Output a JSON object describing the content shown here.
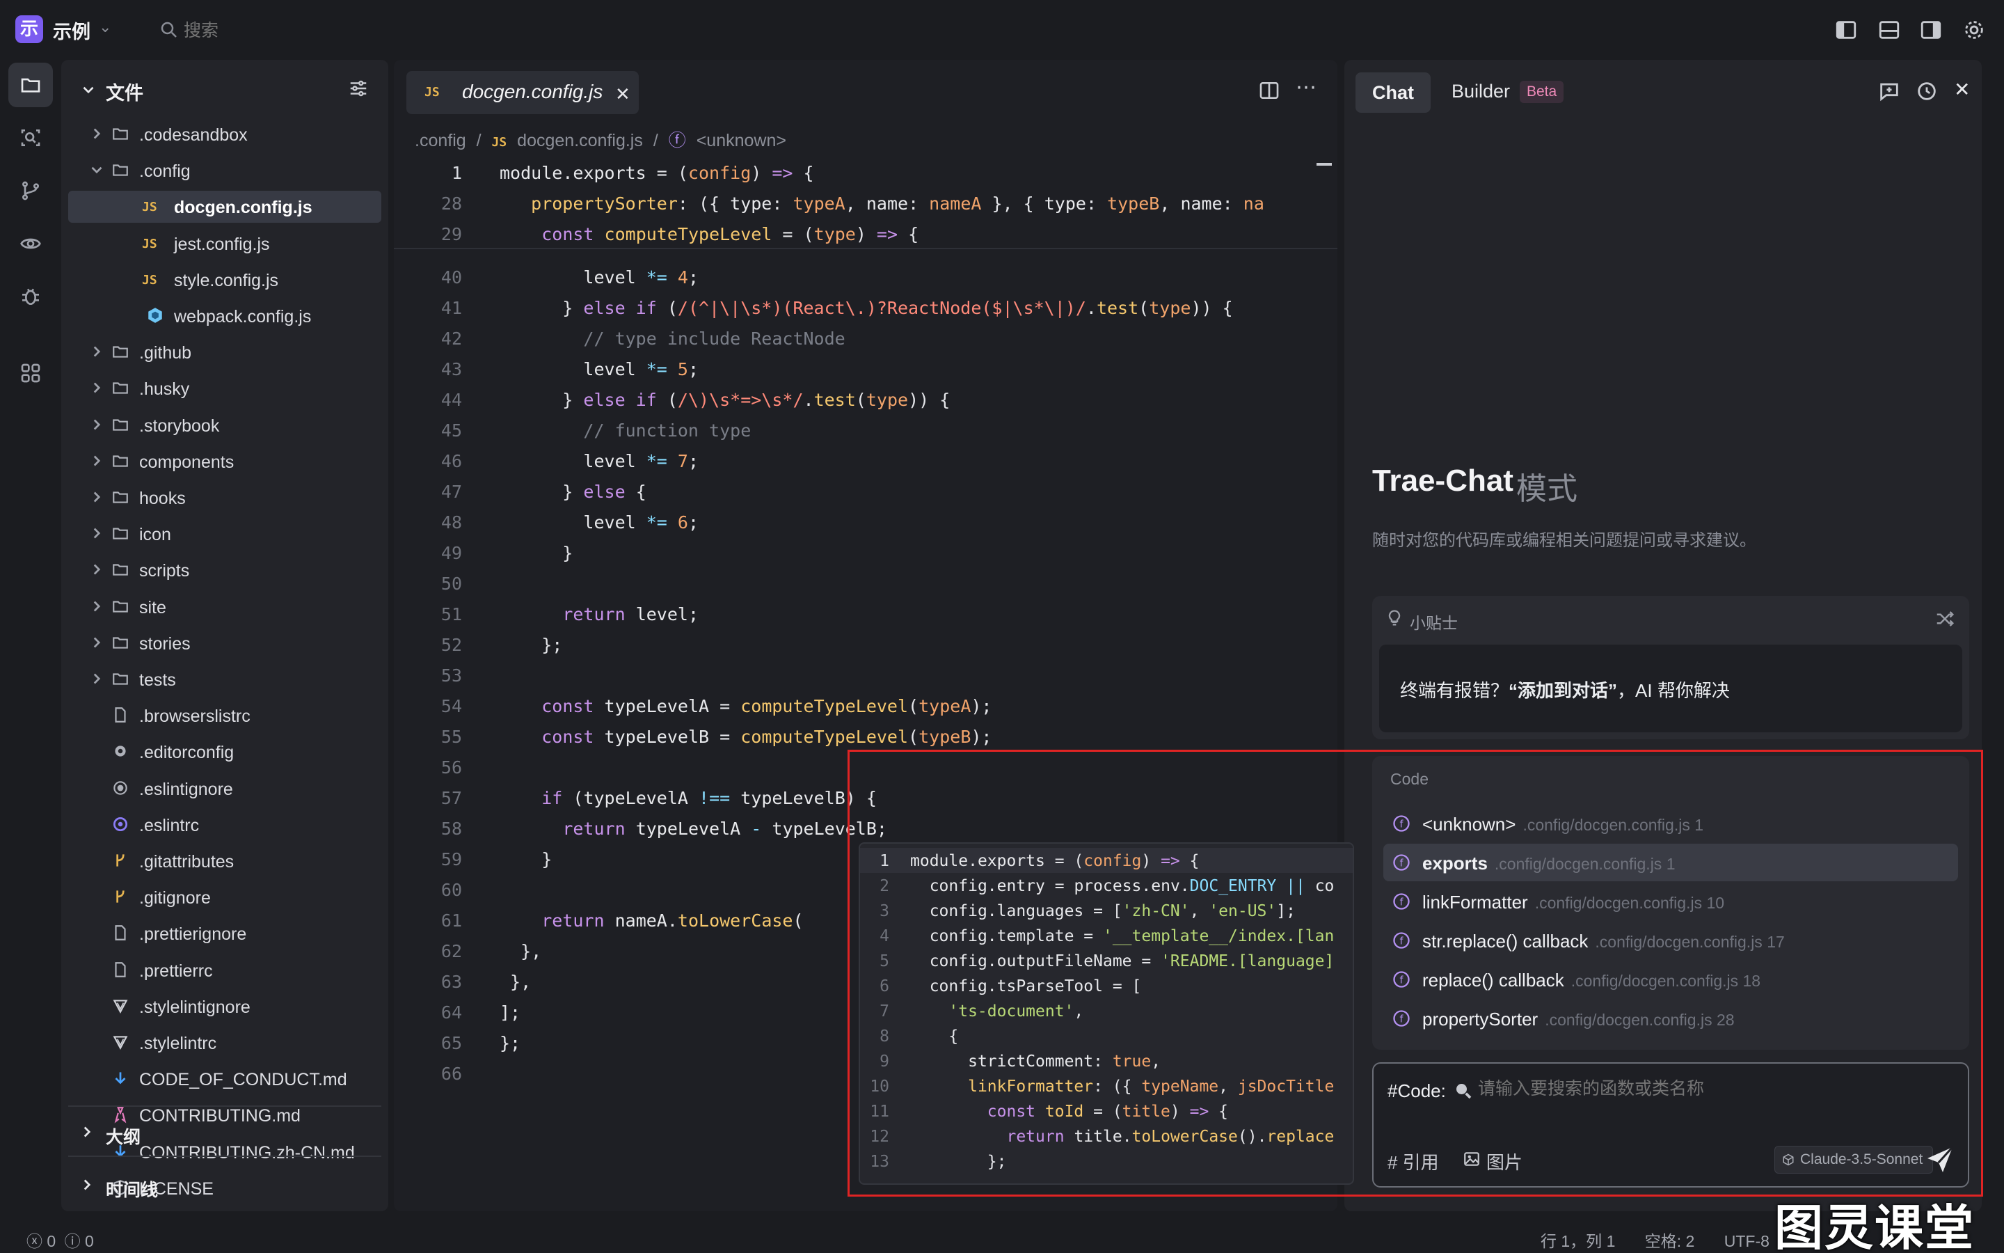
{
  "titlebar": {
    "logo_char": "示",
    "project": "示例",
    "search_placeholder": "搜索"
  },
  "explorer": {
    "title": "文件",
    "items": [
      {
        "label": ".codesandbox",
        "type": "folder",
        "depth": 0,
        "open": false
      },
      {
        "label": ".config",
        "type": "folder",
        "depth": 0,
        "open": true
      },
      {
        "label": "docgen.config.js",
        "type": "js",
        "depth": 1,
        "selected": true
      },
      {
        "label": "jest.config.js",
        "type": "js",
        "depth": 1
      },
      {
        "label": "style.config.js",
        "type": "js",
        "depth": 1
      },
      {
        "label": "webpack.config.js",
        "type": "webpack",
        "depth": 1
      },
      {
        "label": ".github",
        "type": "folder",
        "depth": 0
      },
      {
        "label": ".husky",
        "type": "folder",
        "depth": 0
      },
      {
        "label": ".storybook",
        "type": "folder",
        "depth": 0
      },
      {
        "label": "components",
        "type": "folder",
        "depth": 0
      },
      {
        "label": "hooks",
        "type": "folder",
        "depth": 0
      },
      {
        "label": "icon",
        "type": "folder",
        "depth": 0
      },
      {
        "label": "scripts",
        "type": "folder",
        "depth": 0
      },
      {
        "label": "site",
        "type": "folder",
        "depth": 0
      },
      {
        "label": "stories",
        "type": "folder",
        "depth": 0
      },
      {
        "label": "tests",
        "type": "folder",
        "depth": 0
      },
      {
        "label": ".browserslistrc",
        "type": "file",
        "depth": 0
      },
      {
        "label": ".editorconfig",
        "type": "gear",
        "depth": 0
      },
      {
        "label": ".eslintignore",
        "type": "circle",
        "depth": 0
      },
      {
        "label": ".eslintrc",
        "type": "eslint",
        "depth": 0
      },
      {
        "label": ".gitattributes",
        "type": "git",
        "depth": 0
      },
      {
        "label": ".gitignore",
        "type": "git",
        "depth": 0
      },
      {
        "label": ".prettierignore",
        "type": "file",
        "depth": 0
      },
      {
        "label": ".prettierrc",
        "type": "file",
        "depth": 0
      },
      {
        "label": ".stylelintignore",
        "type": "stylelint",
        "depth": 0
      },
      {
        "label": ".stylelintrc",
        "type": "stylelint",
        "depth": 0
      },
      {
        "label": "CODE_OF_CONDUCT.md",
        "type": "md",
        "depth": 0
      },
      {
        "label": "CONTRIBUTING.md",
        "type": "ribbon",
        "depth": 0
      },
      {
        "label": "CONTRIBUTING.zh-CN.md",
        "type": "md",
        "depth": 0
      },
      {
        "label": "LICENSE",
        "type": "license",
        "depth": 0
      }
    ],
    "outline_label": "大纲",
    "timeline_label": "时间线"
  },
  "editor": {
    "tab_badge": "JS",
    "tab_title": "docgen.config.js",
    "breadcrumb": [
      ".config",
      "/",
      "JS",
      "docgen.config.js",
      "/",
      "<unknown>"
    ],
    "sticky": [
      {
        "n": "1",
        "html": "<span class='v'>module</span>.<span class='v'>exports</span> = (<span class='n'>config</span>) <span class='k'>=&gt;</span> {"
      },
      {
        "n": "28",
        "html": "   <span class='f'>propertySorter</span>: ({ <span class='v'>type</span>: <span class='n'>typeA</span>, <span class='v'>name</span>: <span class='n'>nameA</span> }, { <span class='v'>type</span>: <span class='n'>typeB</span>, <span class='v'>name</span>: <span class='n'>na</span>"
      },
      {
        "n": "29",
        "html": "    <span class='k'>const</span> <span class='f'>computeTypeLevel</span> = (<span class='n'>type</span>) <span class='k'>=&gt;</span> {"
      }
    ],
    "lines": [
      {
        "n": "40",
        "html": "        <span class='v'>level</span> <span class='o'>*=</span> <span class='n'>4</span>;"
      },
      {
        "n": "41",
        "html": "      } <span class='k'>else if</span> (<span class='r'>/(^|\\|\\s*)(React\\.)?ReactNode($|\\s*\\|)/</span>.<span class='f'>test</span>(<span class='n'>type</span>)) {"
      },
      {
        "n": "42",
        "html": "        <span class='c'>// type include ReactNode</span>"
      },
      {
        "n": "43",
        "html": "        <span class='v'>level</span> <span class='o'>*=</span> <span class='n'>5</span>;"
      },
      {
        "n": "44",
        "html": "      } <span class='k'>else if</span> (<span class='r'>/\\)\\s*=&gt;\\s*/</span>.<span class='f'>test</span>(<span class='n'>type</span>)) {"
      },
      {
        "n": "45",
        "html": "        <span class='c'>// function type</span>"
      },
      {
        "n": "46",
        "html": "        <span class='v'>level</span> <span class='o'>*=</span> <span class='n'>7</span>;"
      },
      {
        "n": "47",
        "html": "      } <span class='k'>else</span> {"
      },
      {
        "n": "48",
        "html": "        <span class='v'>level</span> <span class='o'>*=</span> <span class='n'>6</span>;"
      },
      {
        "n": "49",
        "html": "      }"
      },
      {
        "n": "50",
        "html": ""
      },
      {
        "n": "51",
        "html": "      <span class='k'>return</span> <span class='v'>level</span>;"
      },
      {
        "n": "52",
        "html": "    };"
      },
      {
        "n": "53",
        "html": ""
      },
      {
        "n": "54",
        "html": "    <span class='k'>const</span> <span class='v'>typeLevelA</span> = <span class='f'>computeTypeLevel</span>(<span class='n'>typeA</span>);"
      },
      {
        "n": "55",
        "html": "    <span class='k'>const</span> <span class='v'>typeLevelB</span> = <span class='f'>computeTypeLevel</span>(<span class='n'>typeB</span>);"
      },
      {
        "n": "56",
        "html": ""
      },
      {
        "n": "57",
        "html": "    <span class='k'>if</span> (<span class='v'>typeLevelA</span> <span class='o'>!==</span> <span class='v'>typeLevelB</span>) {"
      },
      {
        "n": "58",
        "html": "      <span class='k'>return</span> <span class='v'>typeLevelA</span> <span class='o'>-</span> <span class='v'>typeLevelB</span>;"
      },
      {
        "n": "59",
        "html": "    }"
      },
      {
        "n": "60",
        "html": ""
      },
      {
        "n": "61",
        "html": "    <span class='k'>return</span> <span class='v'>nameA</span>.<span class='f'>toLowerCase</span>("
      },
      {
        "n": "62",
        "html": "  },"
      },
      {
        "n": "63",
        "html": " },"
      },
      {
        "n": "64",
        "html": "];"
      },
      {
        "n": "65",
        "html": "};"
      },
      {
        "n": "66",
        "html": ""
      }
    ]
  },
  "preview": {
    "lines": [
      {
        "n": "1",
        "html": "<span class='v'>module</span>.<span class='v'>exports</span> = (<span class='n'>config</span>) <span class='k'>=&gt;</span> {"
      },
      {
        "n": "2",
        "html": "  <span class='v'>config</span>.<span class='v'>entry</span> = <span class='v'>process</span>.<span class='v'>env</span>.<span class='o'>DOC_ENTRY</span> <span class='o'>||</span> <span class='v'>co</span>"
      },
      {
        "n": "3",
        "html": "  <span class='v'>config</span>.<span class='v'>languages</span> = [<span class='s'>'zh-CN'</span>, <span class='s'>'en-US'</span>];"
      },
      {
        "n": "4",
        "html": "  <span class='v'>config</span>.<span class='v'>template</span> = <span class='s'>'__template__/index.[lan</span>"
      },
      {
        "n": "5",
        "html": "  <span class='v'>config</span>.<span class='v'>outputFileName</span> = <span class='s'>'README.[language]</span>"
      },
      {
        "n": "6",
        "html": "  <span class='v'>config</span>.<span class='v'>tsParseTool</span> = ["
      },
      {
        "n": "7",
        "html": "    <span class='s'>'ts-document'</span>,"
      },
      {
        "n": "8",
        "html": "    {"
      },
      {
        "n": "9",
        "html": "      <span class='v'>strictComment</span>: <span class='n'>true</span>,"
      },
      {
        "n": "10",
        "html": "      <span class='f'>linkFormatter</span>: ({ <span class='n'>typeName</span>, <span class='n'>jsDocTitle</span>"
      },
      {
        "n": "11",
        "html": "        <span class='k'>const</span> <span class='f'>toId</span> = (<span class='n'>title</span>) <span class='k'>=&gt;</span> {"
      },
      {
        "n": "12",
        "html": "          <span class='k'>return</span> <span class='v'>title</span>.<span class='f'>toLowerCase</span>().<span class='f'>replace</span>"
      },
      {
        "n": "13",
        "html": "        };"
      }
    ]
  },
  "chat": {
    "tab_chat": "Chat",
    "tab_builder": "Builder",
    "beta": "Beta",
    "hero_title": "Trae-Chat",
    "hero_mode": "模式",
    "hero_sub": "随时对您的代码库或编程相关问题提问或寻求建议。",
    "tip_label": "小贴士",
    "tip_text_a": "终端有报错？",
    "tip_text_b": "“添加到对话”",
    "tip_text_c": "，AI 帮你解决",
    "suggest_title": "Code",
    "suggestions": [
      {
        "name": "<unknown>",
        "path": ".config/docgen.config.js 1"
      },
      {
        "name": "exports",
        "path": ".config/docgen.config.js 1",
        "highlighted": true
      },
      {
        "name": "linkFormatter",
        "path": ".config/docgen.config.js 10"
      },
      {
        "name": "str.replace() callback",
        "path": ".config/docgen.config.js 17"
      },
      {
        "name": "replace() callback",
        "path": ".config/docgen.config.js 18"
      },
      {
        "name": "propertySorter",
        "path": ".config/docgen.config.js 28"
      }
    ],
    "input_tag": "#Code:",
    "input_placeholder": "请输入要搜索的函数或类名称",
    "ref_btn": "# 引用",
    "img_btn": "图片",
    "model": "Claude-3.5-Sonnet"
  },
  "status": {
    "errors": "0",
    "warnings": "0",
    "position": "行 1，列 1",
    "spaces": "空格: 2",
    "encoding": "UTF-8",
    "watermark": "图灵课堂"
  },
  "colors": {
    "accent": "#7b5cf0",
    "highlight_frame": "#e02424",
    "beta": "#ef8ab8"
  }
}
